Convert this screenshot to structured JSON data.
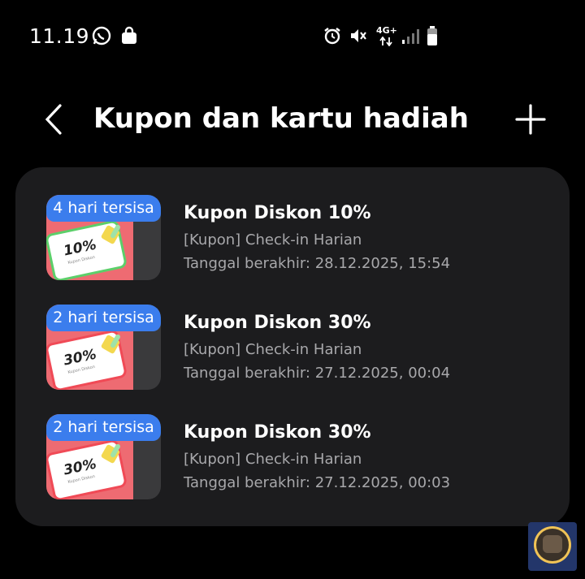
{
  "status_bar": {
    "time": "11.19",
    "network": "4G+",
    "icons": [
      "whatsapp-icon",
      "shopping-bag-icon",
      "alarm-icon",
      "mute-icon",
      "network-4g-icon",
      "signal-icon",
      "battery-icon"
    ]
  },
  "header": {
    "title": "Kupon dan kartu hadiah",
    "back_icon": "chevron-left-icon",
    "add_icon": "plus-icon"
  },
  "coupons": [
    {
      "badge": "4 hari tersisa",
      "thumb_pct": "10%",
      "name": "Kupon Diskon 10%",
      "source": "[Kupon] Check-in Harian",
      "expiry": "Tanggal berakhir: 28.12.2025, 15:54",
      "thumb_accent": "#5ccf6a"
    },
    {
      "badge": "2 hari tersisa",
      "thumb_pct": "30%",
      "name": "Kupon Diskon 30%",
      "source": "[Kupon] Check-in Harian",
      "expiry": "Tanggal berakhir: 27.12.2025, 00:04",
      "thumb_accent": "#f04a56"
    },
    {
      "badge": "2 hari tersisa",
      "thumb_pct": "30%",
      "name": "Kupon Diskon 30%",
      "source": "[Kupon] Check-in Harian",
      "expiry": "Tanggal berakhir: 27.12.2025, 00:03",
      "thumb_accent": "#f04a56"
    }
  ],
  "colors": {
    "background": "#000000",
    "card": "#1c1c1e",
    "badge": "#3b7ded",
    "secondary_text": "#a8a8ab"
  }
}
